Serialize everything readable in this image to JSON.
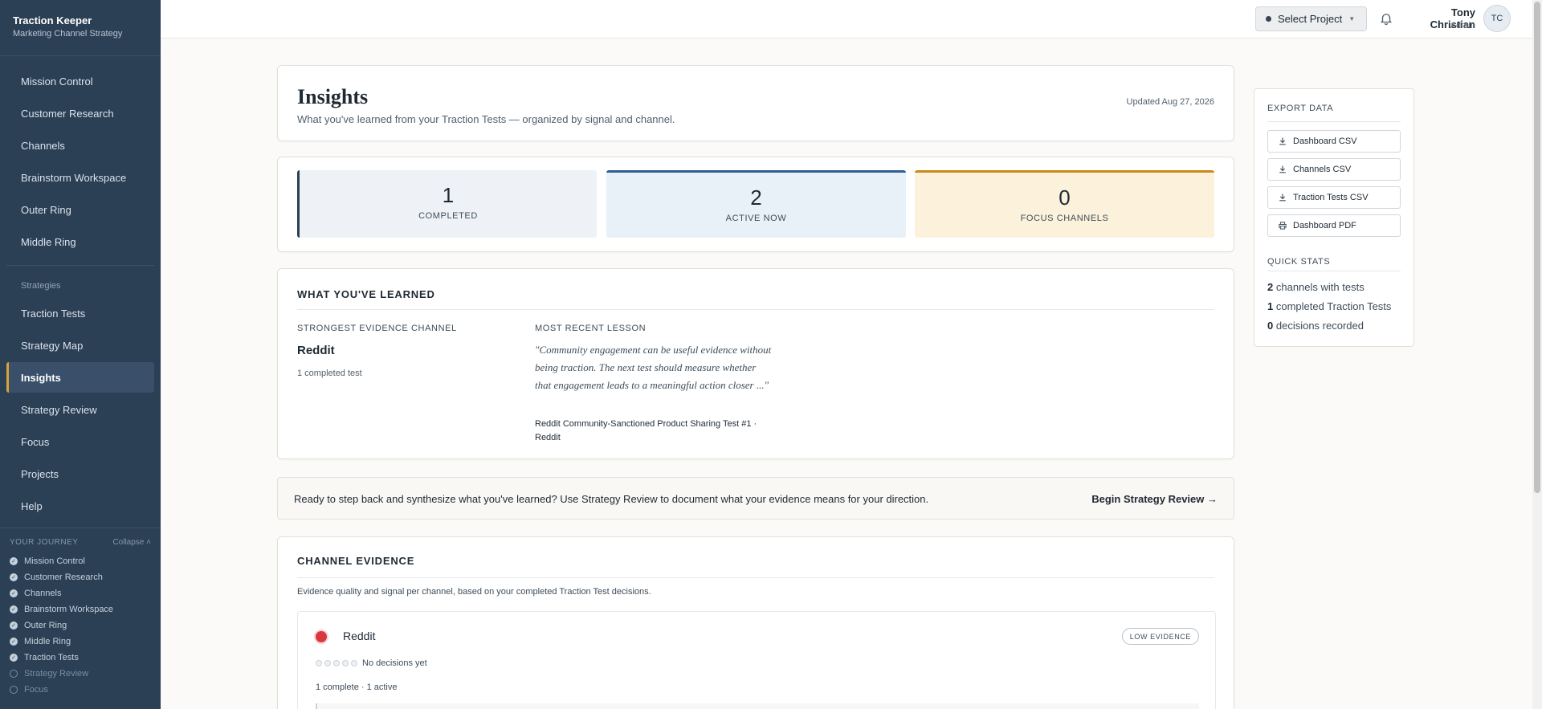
{
  "brand": {
    "title": "Traction Keeper",
    "subtitle": "Marketing Channel Strategy"
  },
  "nav": {
    "primary": [
      "Mission Control",
      "Customer Research",
      "Channels",
      "Brainstorm Workspace",
      "Outer Ring",
      "Middle Ring"
    ],
    "section_label": "Strategies",
    "secondary": [
      "Traction Tests",
      "Strategy Map",
      "Insights",
      "Strategy Review",
      "Focus",
      "Projects",
      "Help"
    ],
    "active": "Insights"
  },
  "journey": {
    "title": "YOUR JOURNEY",
    "collapse_label": "Collapse",
    "items": [
      {
        "label": "Mission Control",
        "done": true
      },
      {
        "label": "Customer Research",
        "done": true
      },
      {
        "label": "Channels",
        "done": true
      },
      {
        "label": "Brainstorm Workspace",
        "done": true
      },
      {
        "label": "Outer Ring",
        "done": true
      },
      {
        "label": "Middle Ring",
        "done": true
      },
      {
        "label": "Traction Tests",
        "done": true
      },
      {
        "label": "Strategy Review",
        "done": false
      },
      {
        "label": "Focus",
        "done": false
      }
    ]
  },
  "topbar": {
    "project_button": "Select Project",
    "user_name": "Tony Christian",
    "user_role": "Admin",
    "avatar_initials": "TC",
    "bell_icon": "bell-icon"
  },
  "header": {
    "title": "Insights",
    "subtitle": "What you've learned from your Traction Tests — organized by signal and channel.",
    "updated": "Updated Aug 27, 2026"
  },
  "stats": [
    {
      "value": "1",
      "label": "COMPLETED"
    },
    {
      "value": "2",
      "label": "ACTIVE NOW"
    },
    {
      "value": "0",
      "label": "FOCUS CHANNELS"
    }
  ],
  "learned": {
    "title": "WHAT YOU'VE LEARNED",
    "strongest_label": "STRONGEST EVIDENCE CHANNEL",
    "strongest_channel": "Reddit",
    "strongest_meta": "1 completed test",
    "recent_label": "MOST RECENT LESSON",
    "recent_quote": "\"Community engagement can be useful evidence without being traction. The next test should measure whether that engagement leads to a meaningful action closer ...\"",
    "recent_source": "Reddit Community-Sanctioned Product Sharing Test #1 · Reddit"
  },
  "banner": {
    "text": "Ready to step back and synthesize what you've learned? Use Strategy Review to document what your evidence means for your direction.",
    "link": "Begin Strategy Review →"
  },
  "evidence": {
    "title": "CHANNEL EVIDENCE",
    "description": "Evidence quality and signal per channel, based on your completed Traction Test decisions.",
    "channel": {
      "name": "Reddit",
      "badge": "LOW EVIDENCE",
      "decisions": "No decisions yet",
      "counts": "1 complete · 1 active",
      "status_color": "#d9363e"
    }
  },
  "export": {
    "title": "EXPORT DATA",
    "buttons": [
      {
        "label": "Dashboard CSV",
        "icon": "download-icon"
      },
      {
        "label": "Channels CSV",
        "icon": "download-icon"
      },
      {
        "label": "Traction Tests CSV",
        "icon": "download-icon"
      },
      {
        "label": "Dashboard PDF",
        "icon": "printer-icon"
      }
    ]
  },
  "quick_stats": {
    "title": "QUICK STATS",
    "items": [
      {
        "value": "2",
        "label": "channels with tests"
      },
      {
        "value": "1",
        "label": "completed Traction Tests"
      },
      {
        "value": "0",
        "label": "decisions recorded"
      }
    ]
  },
  "colors": {
    "sidebar": "#2b3f55",
    "accent": "#d7a23c",
    "completed": "#2b3f55",
    "active": "#2c5f8f",
    "focus": "#c98a1d"
  }
}
